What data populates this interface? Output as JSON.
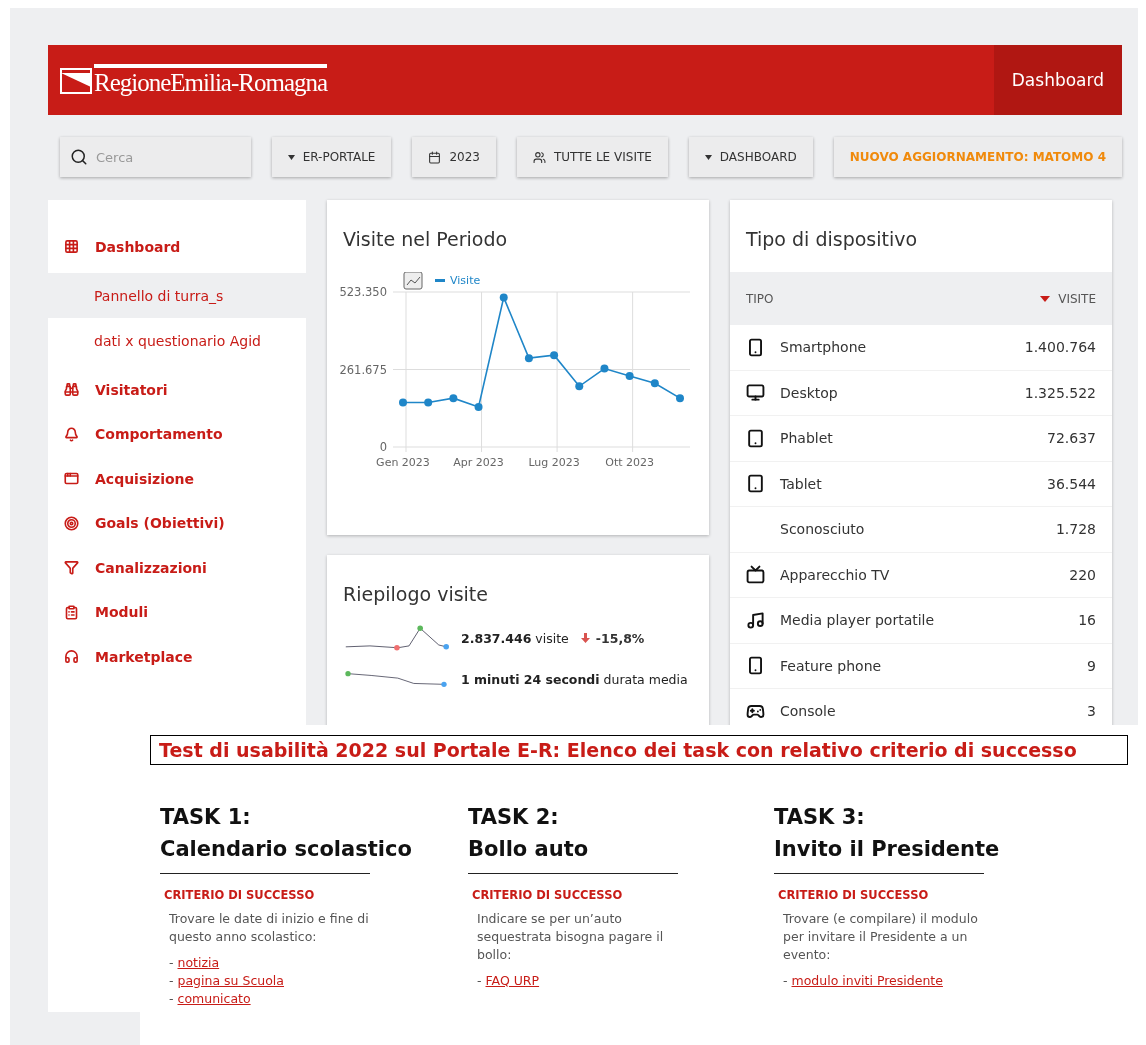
{
  "header": {
    "logo": "RegioneEmilia-Romagna",
    "tabs": [
      {
        "label": "Dashboard",
        "selected": true
      }
    ]
  },
  "toolbar": {
    "search": {
      "placeholder": "Cerca"
    },
    "buttons": [
      {
        "label": "ER-PORTALE",
        "kind": "dropdown"
      },
      {
        "label": "2023",
        "kind": "calendar"
      },
      {
        "label": "TUTTE LE VISITE",
        "kind": "segment"
      },
      {
        "label": "DASHBOARD",
        "kind": "dropdown"
      },
      {
        "label": "NUOVO AGGIORNAMENTO: MATOMO 4",
        "kind": "notice"
      }
    ]
  },
  "sidebar": {
    "items": [
      {
        "label": "Dashboard",
        "children": [
          {
            "label": "Pannello di turra_s",
            "selected": true
          },
          {
            "label": "dati x questionario Agid",
            "selected": false
          }
        ]
      },
      {
        "label": "Visitatori"
      },
      {
        "label": "Comportamento"
      },
      {
        "label": "Acquisizione"
      },
      {
        "label": "Goals (Obiettivi)"
      },
      {
        "label": "Canalizzazioni"
      },
      {
        "label": "Moduli"
      },
      {
        "label": "Marketplace"
      }
    ]
  },
  "visits_chart": {
    "title": "Visite nel Periodo",
    "chart_data": {
      "type": "line",
      "categories": [
        "Gen 2023",
        null,
        null,
        "Apr 2023",
        null,
        null,
        "Lug 2023",
        null,
        null,
        "Ott 2023",
        null,
        null
      ],
      "grid": true,
      "series": [
        {
          "name": "Visite",
          "color": "#1f86c8",
          "marker": "circle",
          "values": [
            150000,
            150000,
            165000,
            135000,
            505000,
            300000,
            310000,
            205000,
            265000,
            240000,
            215000,
            165000
          ]
        }
      ],
      "ylim": [
        0,
        523350
      ],
      "yticks": [
        {
          "value": 0,
          "label": "0"
        },
        {
          "value": 261675,
          "label": "261.675"
        },
        {
          "value": 523350,
          "label": "523.350"
        }
      ]
    }
  },
  "summary": {
    "title": "Riepilogo visite",
    "rows": [
      {
        "text": "**2.837.446** visite",
        "falling": true,
        "change": "-15,8%"
      },
      {
        "text": "**1 minuti 24 secondi** durata media"
      }
    ]
  },
  "devices": {
    "title": "Tipo di dispositivo",
    "columns": [
      {
        "label": "TIPO",
        "sorted": false
      },
      {
        "label": "VISITE",
        "sorted": true
      }
    ],
    "rows": [
      {
        "type": "Smartphone",
        "visits": "1.400.764"
      },
      {
        "type": "Desktop",
        "visits": "1.325.522"
      },
      {
        "type": "Phablet",
        "visits": "72.637"
      },
      {
        "type": "Tablet",
        "visits": "36.544"
      },
      {
        "type": "Sconosciuto",
        "visits": "1.728"
      },
      {
        "type": "Apparecchio TV",
        "visits": "220"
      },
      {
        "type": "Media player portatile",
        "visits": "16"
      },
      {
        "type": "Feature phone",
        "visits": "9"
      },
      {
        "type": "Console",
        "visits": "3"
      }
    ]
  },
  "overlay": {
    "title": "Test di usabilità 2022 sul Portale E-R: Elenco dei task con relativo criterio di successo",
    "tasks": [
      {
        "number": "TASK 1:",
        "name": "Calendario scolastico",
        "criterion_label": "CRITERIO DI SUCCESSO",
        "description": "Trovare le date di inizio e fine di questo anno scolastico:",
        "links": [
          {
            "prefix": "-",
            "text": "notizia"
          },
          {
            "prefix": "-",
            "text": "pagina su Scuola"
          },
          {
            "prefix": "-",
            "text": "comunicato"
          }
        ]
      },
      {
        "number": "TASK 2:",
        "name": "Bollo auto",
        "criterion_label": "CRITERIO DI SUCCESSO",
        "description": "Indicare se per un’auto sequestrata bisogna pagare il bollo:",
        "links": [
          {
            "prefix": "-",
            "text": "FAQ URP"
          }
        ]
      },
      {
        "number": "TASK 3:",
        "name": "Invito il Presidente",
        "criterion_label": "CRITERIO DI SUCCESSO",
        "description": "Trovare (e compilare) il modulo per invitare il Presidente a un evento:",
        "links": [
          {
            "prefix": "-",
            "text": "modulo inviti Presidente"
          }
        ]
      }
    ]
  }
}
